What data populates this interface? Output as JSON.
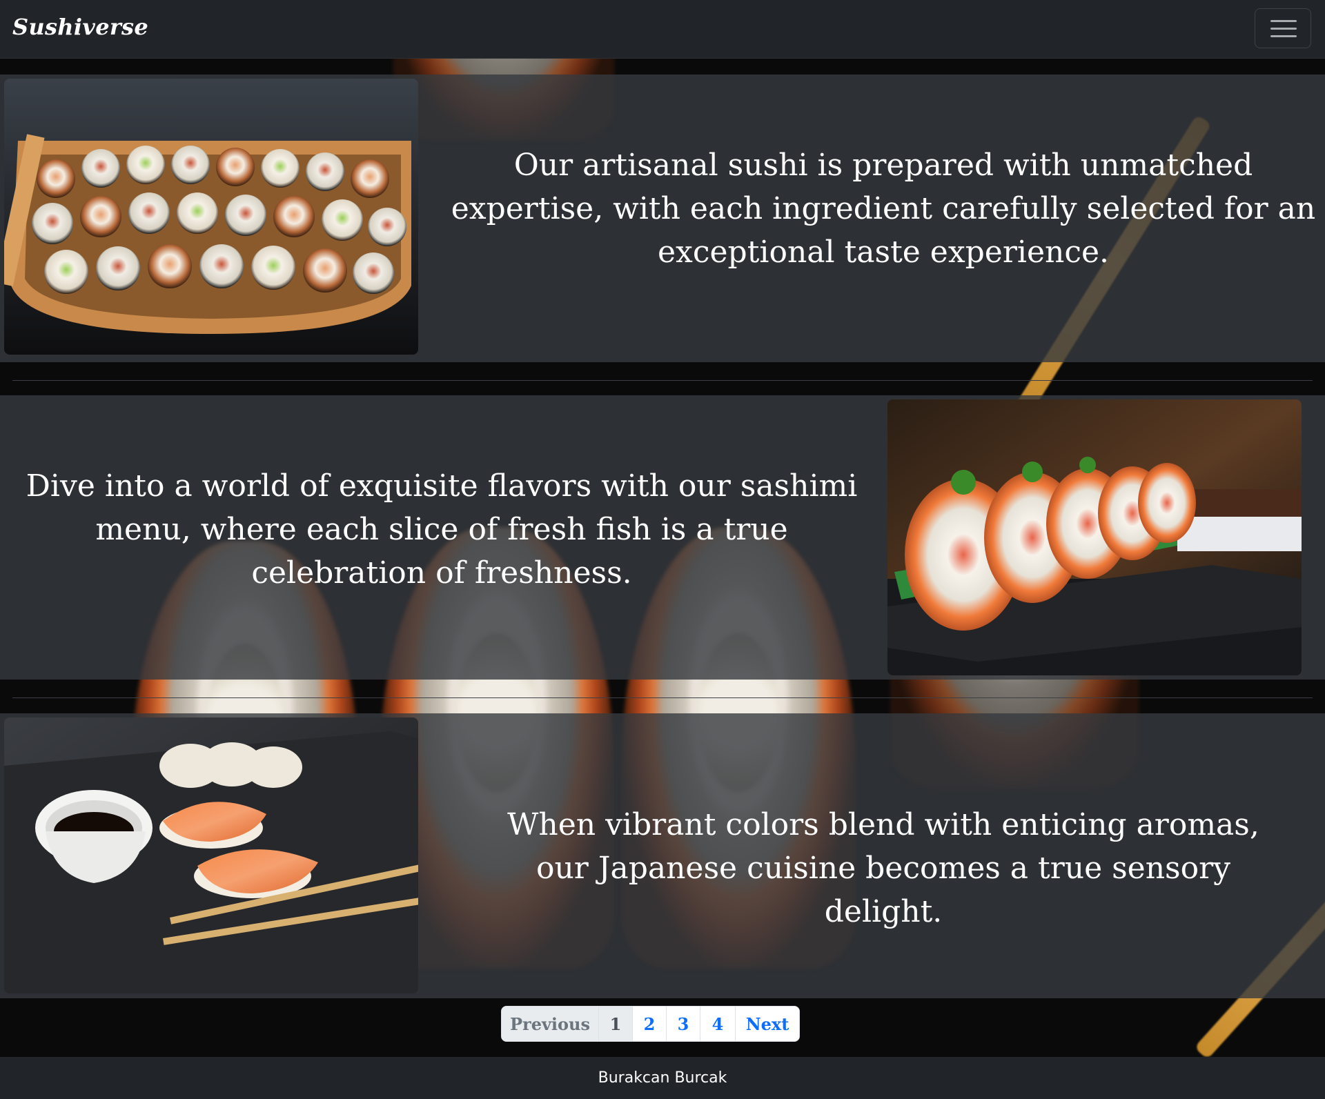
{
  "navbar": {
    "brand": "Sushiverse",
    "toggle_icon": "hamburger-menu-icon"
  },
  "sections": [
    {
      "text": "Our artisanal sushi is prepared with unmatched expertise, with each ingredient carefully selected for an exceptional taste experience.",
      "image": "sushi-boat-platter"
    },
    {
      "text": "Dive into a world of exquisite flavors with our sashimi menu, where each slice of fresh fish is a true celebration of freshness.",
      "image": "salmon-sushi-rolls"
    },
    {
      "text": "When vibrant colors blend with enticing aromas, our Japanese cuisine becomes a true sensory delight.",
      "image": "nigiri-soy-sauce-chopsticks"
    }
  ],
  "pagination": {
    "previous": "Previous",
    "pages": [
      "1",
      "2",
      "3",
      "4"
    ],
    "next": "Next"
  },
  "footer": {
    "author": "Burakcan Burcak"
  },
  "colors": {
    "navbar_bg": "#212529",
    "section_bg": "#363a3f",
    "link": "#0d6efd"
  }
}
